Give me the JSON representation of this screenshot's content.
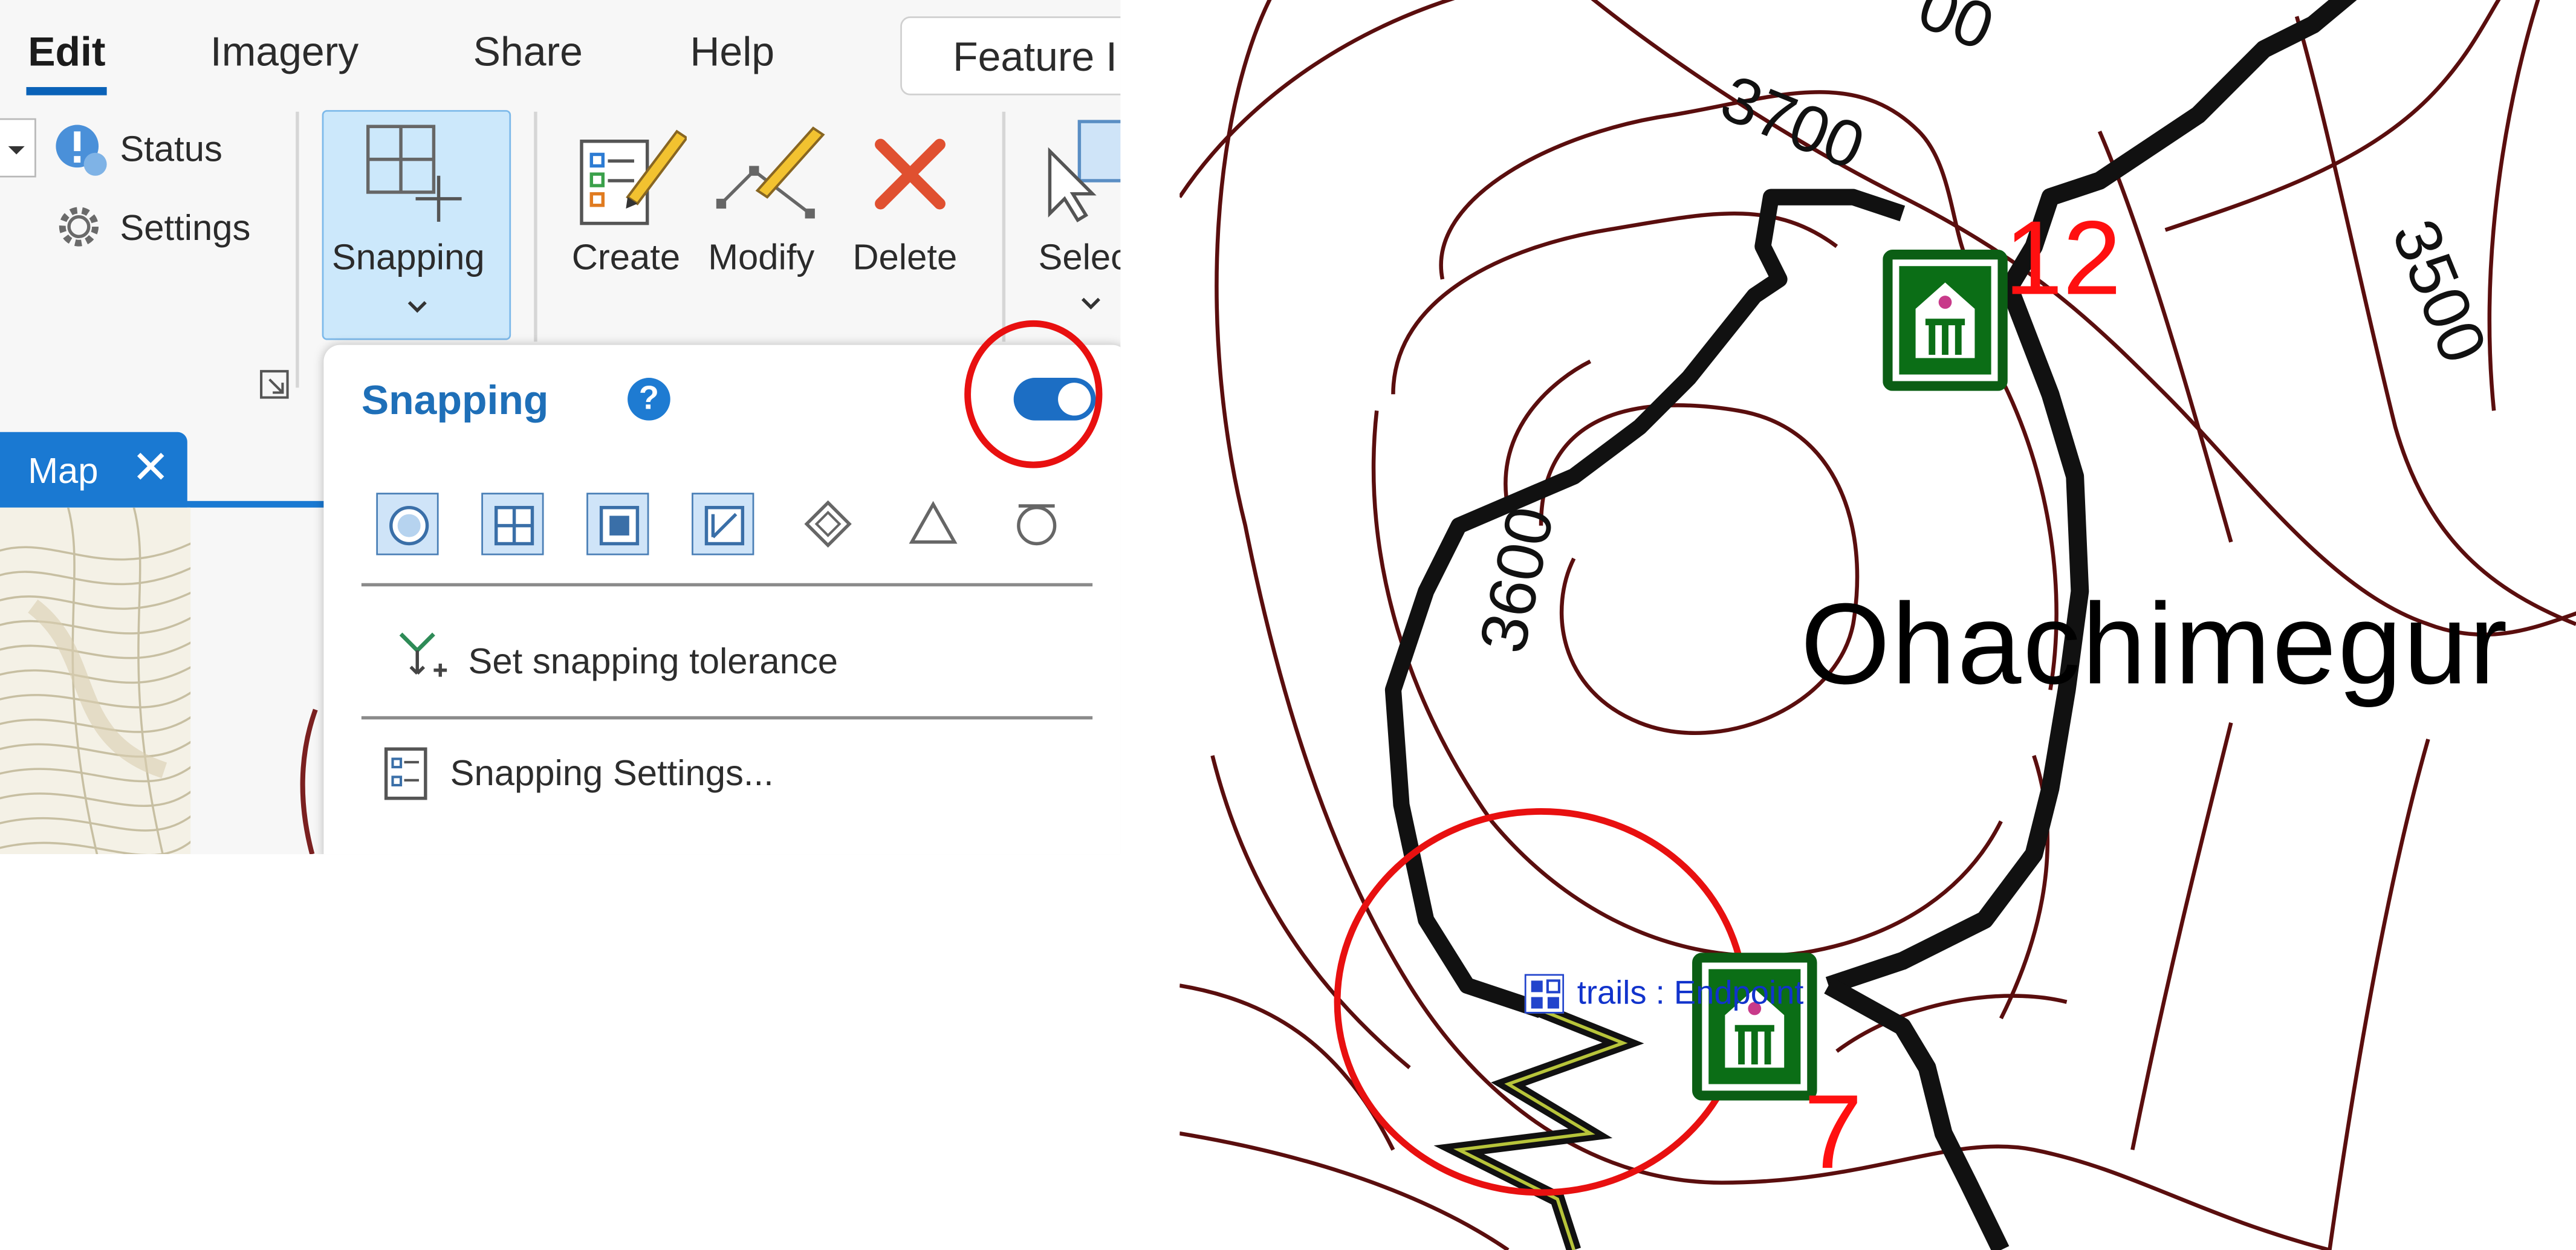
{
  "ribbon": {
    "tabs": [
      {
        "label": "Edit",
        "active": true
      },
      {
        "label": "Imagery"
      },
      {
        "label": "Share"
      },
      {
        "label": "Help"
      }
    ],
    "feature_box_label": "Feature I",
    "status_label": "Status",
    "settings_label": "Settings",
    "snapping_label": "Snapping",
    "create_label": "Create",
    "modify_label": "Modify",
    "delete_label": "Delete",
    "select_label": "Selec"
  },
  "map_tab": {
    "label": "Map",
    "close_glyph": "✕"
  },
  "snapping_dropdown": {
    "title": "Snapping",
    "help_glyph": "?",
    "enabled": true,
    "snap_modes": [
      "point",
      "edge-grid",
      "end",
      "intersection",
      "vertex",
      "midpoint",
      "tangent"
    ],
    "set_tolerance_label": "Set snapping tolerance",
    "settings_label": "Snapping Settings..."
  },
  "map": {
    "contour_labels": [
      "3700",
      "3600",
      "3500",
      "00"
    ],
    "place_name": "Ohachimegur",
    "hut_numbers": [
      "12",
      "7"
    ],
    "snap_tip": "trails : Endpoint"
  },
  "colors": {
    "accent": "#1a79d2",
    "toggle_on": "#1c6ec4",
    "highlight_circle": "#e81010",
    "hut_green": "#0b6e16",
    "contour": "#5a0e0e",
    "hut_number": "#ff1010"
  }
}
